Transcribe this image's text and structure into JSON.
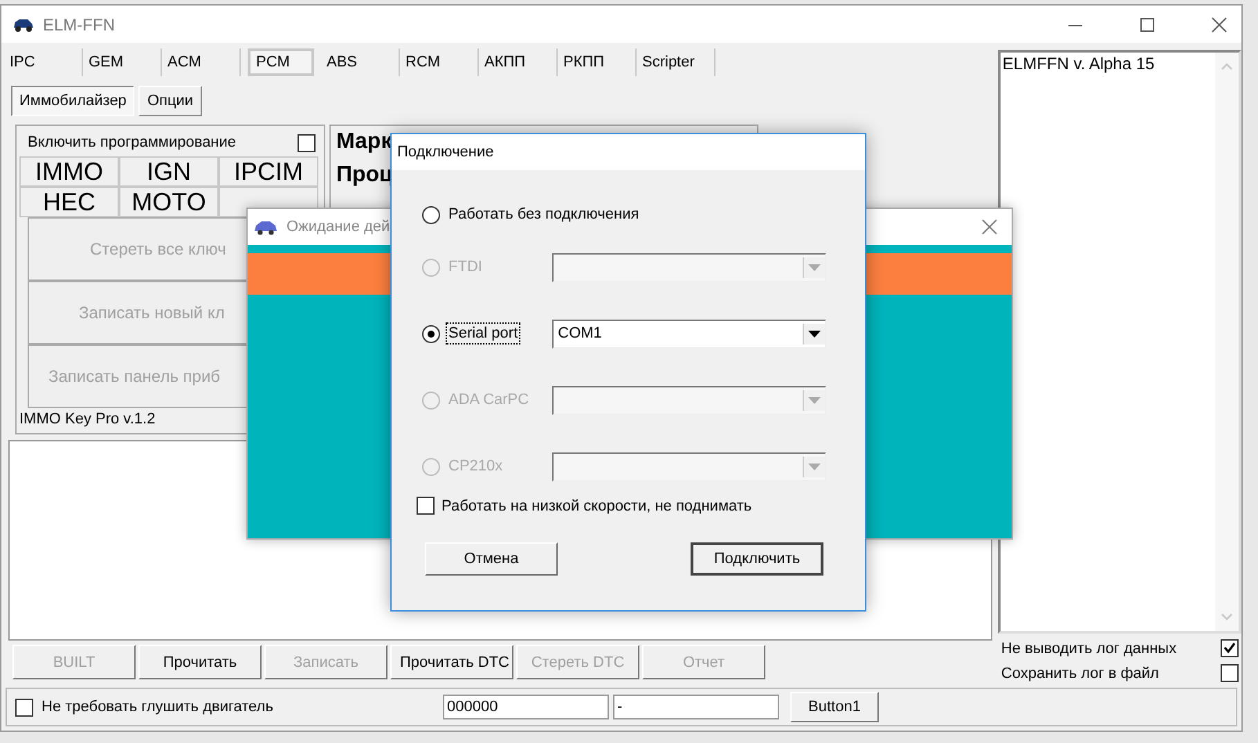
{
  "window": {
    "title": "ELM-FFN"
  },
  "tabs": [
    {
      "label": "IPC",
      "selected": false
    },
    {
      "label": "GEM",
      "selected": false
    },
    {
      "label": "ACM",
      "selected": false
    },
    {
      "label": "PCM",
      "selected": true
    },
    {
      "label": "ABS",
      "selected": false
    },
    {
      "label": "RCM",
      "selected": false
    },
    {
      "label": "АКПП",
      "selected": false
    },
    {
      "label": "РКПП",
      "selected": false
    },
    {
      "label": "Scripter",
      "selected": false
    }
  ],
  "subtabs": [
    {
      "label": "Иммобилайзер",
      "selected": true
    },
    {
      "label": "Опции",
      "selected": false
    }
  ],
  "immo_panel": {
    "enable_label": "Включить программирование",
    "enable_checked": false,
    "modules": [
      "IMMO",
      "IGN",
      "IPCIM",
      "HEC",
      "MOTO"
    ],
    "actions": [
      {
        "label": "Стереть все ключ",
        "disabled": true
      },
      {
        "label": "Записать новый кл",
        "disabled": true
      },
      {
        "label": "Записать панель приб",
        "disabled": true
      }
    ],
    "version": "IMMO Key Pro v.1.2"
  },
  "info_panel": {
    "lines": [
      "Марк",
      "Проц"
    ]
  },
  "action_buttons": [
    {
      "label": "BUILT",
      "disabled": true
    },
    {
      "label": "Прочитать",
      "disabled": false
    },
    {
      "label": "Записать",
      "disabled": true
    },
    {
      "label": "Прочитать DTC",
      "disabled": false
    },
    {
      "label": "Стереть DTC",
      "disabled": true
    },
    {
      "label": "Отчет",
      "disabled": true
    }
  ],
  "log_list": {
    "items": [
      "ELMFFN v. Alpha 15"
    ]
  },
  "log_options": [
    {
      "label": "Не выводить лог данных",
      "checked": true
    },
    {
      "label": "Сохранить лог в файл",
      "checked": false
    }
  ],
  "bottom_bar": {
    "engine_check": {
      "label": "Не требовать глушить двигатель",
      "checked": false
    },
    "field_1": "000000",
    "field_2": "-",
    "button": "Button1"
  },
  "waiting_dialog": {
    "title": "Ожидание дей"
  },
  "connection_dialog": {
    "title": "Подключение",
    "options": [
      {
        "kind": "radio",
        "label": "Работать без подключения",
        "selected": false,
        "disabled": false,
        "focused": false
      },
      {
        "kind": "radio_combo",
        "label": "FTDI",
        "selected": false,
        "disabled": true,
        "focused": false
      },
      {
        "kind": "radio_combo",
        "label": "Serial port",
        "selected": true,
        "disabled": false,
        "focused": true,
        "value": "COM1"
      },
      {
        "kind": "radio_combo",
        "label": "ADA CarPC",
        "selected": false,
        "disabled": true,
        "focused": false
      },
      {
        "kind": "radio_combo",
        "label": "CP210x",
        "selected": false,
        "disabled": true,
        "focused": false
      }
    ],
    "low_speed": {
      "label": "Работать на низкой скорости, не поднимать",
      "checked": false
    },
    "buttons": [
      {
        "label": "Отмена",
        "default": false
      },
      {
        "label": "Подключить",
        "default": true
      }
    ]
  }
}
